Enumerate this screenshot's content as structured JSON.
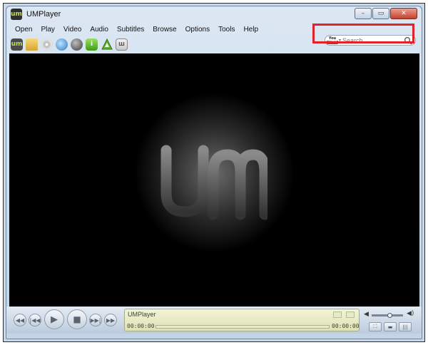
{
  "window": {
    "title": "UMPlayer",
    "minimize_glyph": "–",
    "maximize_glyph": "▭",
    "close_glyph": "✕"
  },
  "menu": [
    "Open",
    "Play",
    "Video",
    "Audio",
    "Subtitles",
    "Browse",
    "Options",
    "Tools",
    "Help"
  ],
  "toolbar": {
    "icons": [
      "um-logo-icon",
      "folder-icon",
      "disc-icon",
      "globe-icon",
      "sphere-icon",
      "info-icon",
      "triangle-icon",
      "grid-icon"
    ],
    "um_label": "um",
    "info_label": "i",
    "grid_label": "Ш"
  },
  "search": {
    "provider_you": "You",
    "provider_tube": "Tube",
    "placeholder": "Search"
  },
  "player": {
    "lcd_title": "UMPlayer",
    "time_current": "00:00:00",
    "time_total": "00:00:00",
    "progress": 0,
    "volume": 0.6
  },
  "colors": {
    "highlight": "#e0222a",
    "accent": "#b7e04a"
  }
}
